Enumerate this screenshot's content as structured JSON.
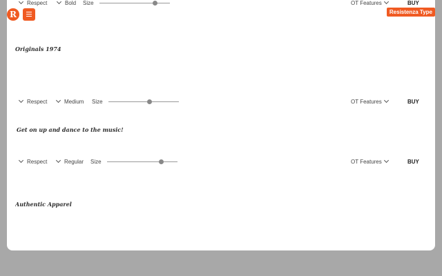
{
  "brand": {
    "logo_glyph": "R",
    "badge_label": "Resistenza Type",
    "accent_color": "#f05a22"
  },
  "rows": [
    {
      "language": "Respect",
      "weight": "Bold",
      "size_label": "Size",
      "size_level": 0.78,
      "ot_label": "OT Features",
      "buy_label": "BUY",
      "specimen_text": "Originals 1974"
    },
    {
      "language": "Respect",
      "weight": "Medium",
      "size_label": "Size",
      "size_level": 0.58,
      "ot_label": "OT Features",
      "buy_label": "BUY",
      "specimen_text": "Get on up and dance to the music!"
    },
    {
      "language": "Respect",
      "weight": "Regular",
      "size_label": "Size",
      "size_level": 0.76,
      "ot_label": "OT Features",
      "buy_label": "BUY",
      "specimen_text": "Authentic Apparel"
    }
  ],
  "icons": {
    "logo": "resistenza-logo-icon",
    "menu": "hamburger-menu-icon",
    "dropdown": "chevron-down-icon"
  }
}
